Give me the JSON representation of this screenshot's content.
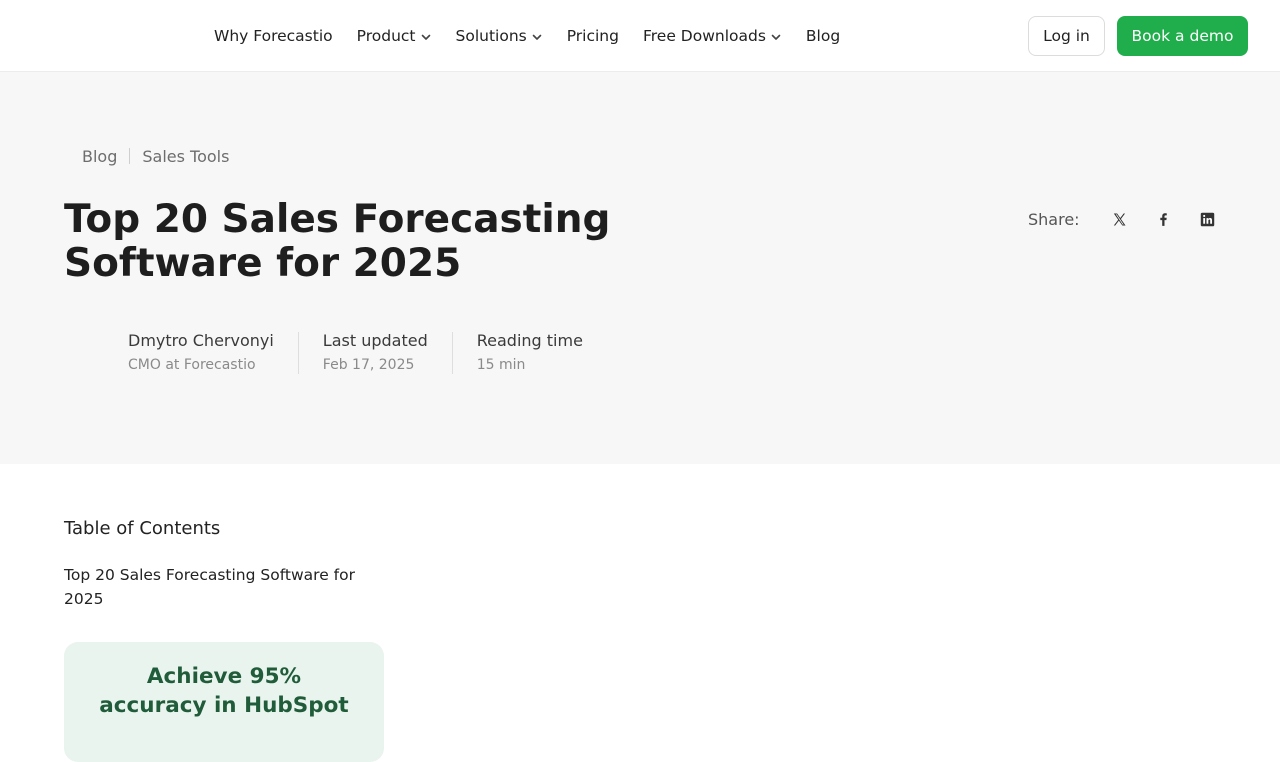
{
  "nav": {
    "items": [
      {
        "label": "Why Forecastio",
        "has_dropdown": false
      },
      {
        "label": "Product",
        "has_dropdown": true
      },
      {
        "label": "Solutions",
        "has_dropdown": true
      },
      {
        "label": "Pricing",
        "has_dropdown": false
      },
      {
        "label": "Free Downloads",
        "has_dropdown": true
      },
      {
        "label": "Blog",
        "has_dropdown": false
      }
    ],
    "login_label": "Log in",
    "demo_label": "Book a demo",
    "accent_color": "#1fae4b"
  },
  "breadcrumb": [
    "Blog",
    "Sales Tools"
  ],
  "article": {
    "title": "Top 20 Sales Forecasting Software for 2025",
    "author_name": "Dmytro Chervonyi",
    "author_role": "CMO at Forecastio",
    "updated_label": "Last updated",
    "updated_value": "Feb 17, 2025",
    "reading_label": "Reading time",
    "reading_value": "15 min"
  },
  "share": {
    "label": "Share:",
    "icons": [
      "x-icon",
      "facebook-icon",
      "linkedin-icon"
    ]
  },
  "toc": {
    "heading": "Table of Contents",
    "items": [
      "Top 20 Sales Forecasting Software for 2025"
    ]
  },
  "promo": {
    "text": "Achieve 95% accuracy in HubSpot"
  }
}
